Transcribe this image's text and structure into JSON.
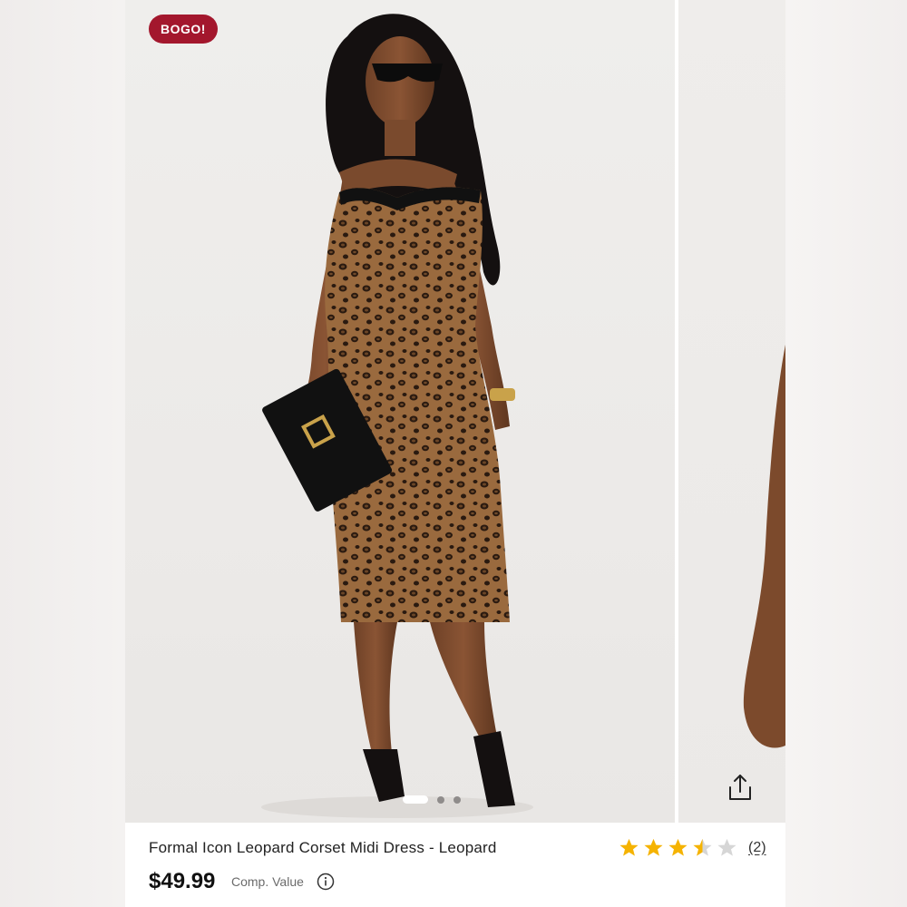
{
  "badge": {
    "label": "BOGO!"
  },
  "carousel": {
    "total_images": 3,
    "active_index": 0
  },
  "product": {
    "title": "Formal Icon Leopard Corset Midi Dress - Leopard",
    "price": "$49.99",
    "comp_value_label": "Comp. Value",
    "rating": 3.5,
    "rating_max": 5,
    "review_count": "(2)"
  },
  "icons": {
    "share": "share-icon",
    "info": "info-icon",
    "star": "star-icon"
  },
  "colors": {
    "badge": "#a3172d",
    "star_filled": "#f5b301",
    "star_empty": "#d6d6d6",
    "price": "#111111"
  }
}
